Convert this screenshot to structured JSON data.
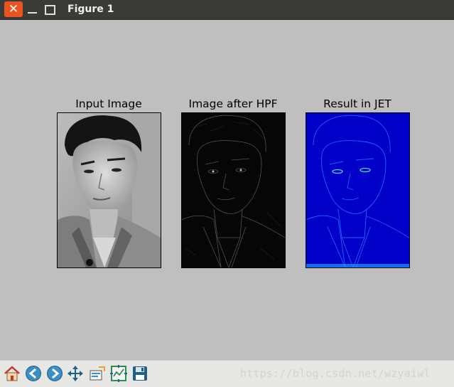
{
  "window": {
    "title": "Figure 1",
    "close_glyph": "✕"
  },
  "figure": {
    "subplots": [
      {
        "title": "Input Image",
        "image": "grayscale-portrait"
      },
      {
        "title": "Image after HPF",
        "image": "high-pass-filtered-edges"
      },
      {
        "title": "Result in JET",
        "image": "jet-colormap-edges"
      }
    ]
  },
  "toolbar": {
    "tools": [
      {
        "name": "home",
        "icon": "home-icon"
      },
      {
        "name": "back",
        "icon": "back-arrow-icon"
      },
      {
        "name": "forward",
        "icon": "forward-arrow-icon"
      },
      {
        "name": "pan",
        "icon": "pan-arrows-icon"
      },
      {
        "name": "zoom",
        "icon": "zoom-rect-icon"
      },
      {
        "name": "configure-subplots",
        "icon": "subplots-icon"
      },
      {
        "name": "save",
        "icon": "save-disk-icon"
      }
    ],
    "watermark": "https://blog.csdn.net/wzyaiwl"
  },
  "colors": {
    "figure_bg": "#bfbfbf",
    "titlebar_bg": "#3a3a37",
    "close_button": "#e95420",
    "jet_bg": "#0000cc"
  }
}
